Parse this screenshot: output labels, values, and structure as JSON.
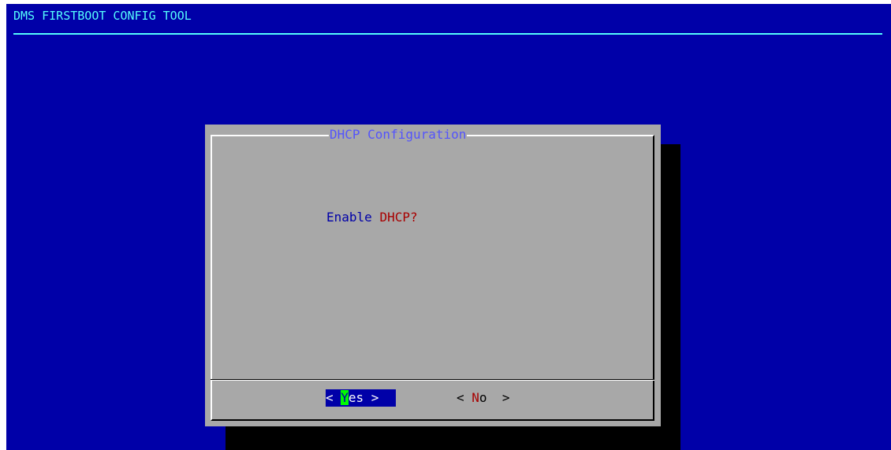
{
  "backtitle": "DMS FIRSTBOOT CONFIG TOOL",
  "dialog": {
    "title": "DHCP Configuration",
    "prompt_prefix": "Enable ",
    "prompt_highlight": "DHCP?",
    "buttons": {
      "yes": {
        "left_bracket": "< ",
        "hotkey": "Y",
        "rest": "es",
        "right_bracket": " >",
        "focused": true
      },
      "no": {
        "left_bracket": "< ",
        "hotkey": "N",
        "rest": "o",
        "right_bracket": "  >",
        "focused": false
      }
    }
  },
  "colors": {
    "screen_bg": "#0000a8",
    "backtitle": "#54fcfc",
    "dialog_bg": "#a8a8a8",
    "title": "#5454fc",
    "highlight": "#a80000",
    "hotkey_bg": "#00fc00",
    "shadow": "#000000"
  }
}
